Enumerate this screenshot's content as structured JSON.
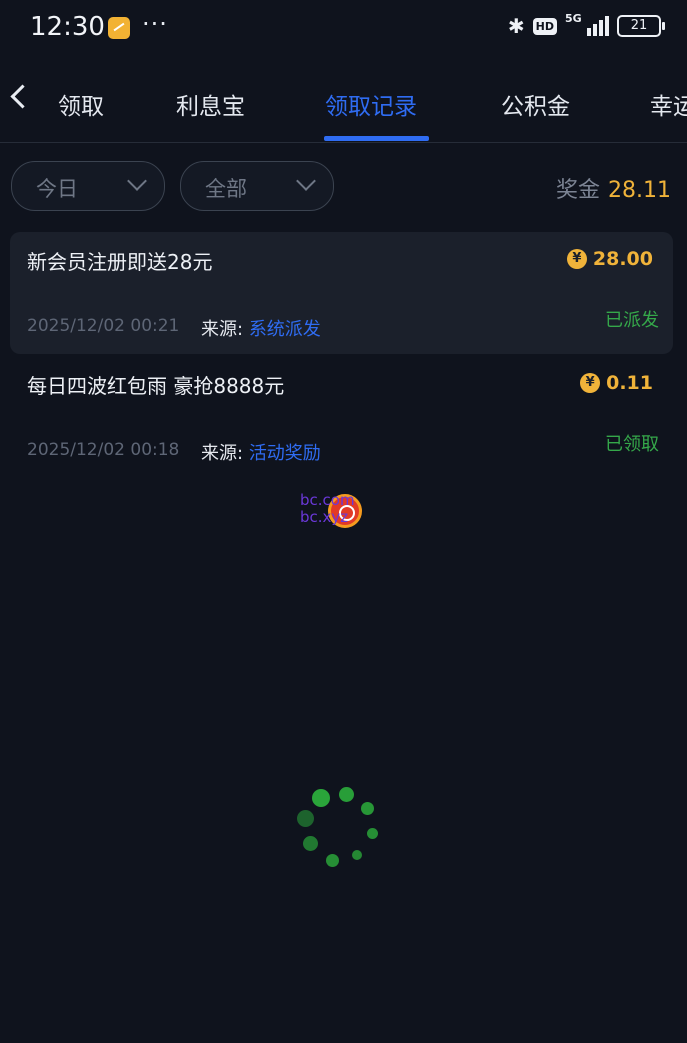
{
  "status_bar": {
    "time": "12:30",
    "more": "···",
    "hd": "HD",
    "network": "5G",
    "battery": "21"
  },
  "tabs": [
    {
      "label": "领取",
      "active": false
    },
    {
      "label": "利息宝",
      "active": false
    },
    {
      "label": "领取记录",
      "active": true
    },
    {
      "label": "公积金",
      "active": false
    },
    {
      "label": "幸运",
      "active": false
    }
  ],
  "filters": {
    "date": "今日",
    "type": "全部"
  },
  "bonus": {
    "label": "奖金",
    "value": "28.11"
  },
  "records": [
    {
      "title": "新会员注册即送28元",
      "currency_symbol": "¥",
      "amount": "28.00",
      "time": "2025/12/02 00:21",
      "source_label": "来源:",
      "source": "系统派发",
      "status": "已派发"
    },
    {
      "title": "每日四波红包雨 豪抢8888元",
      "currency_symbol": "¥",
      "amount": "0.11",
      "time": "2025/12/02 00:18",
      "source_label": "来源:",
      "source": "活动奖励",
      "status": "已领取"
    }
  ],
  "watermark": {
    "line1": "bc.com",
    "line2": "bc.xyz"
  },
  "colors": {
    "accent": "#2f6cf2",
    "gold": "#f0b33a",
    "success": "#35a84a",
    "background": "#0f131d"
  }
}
